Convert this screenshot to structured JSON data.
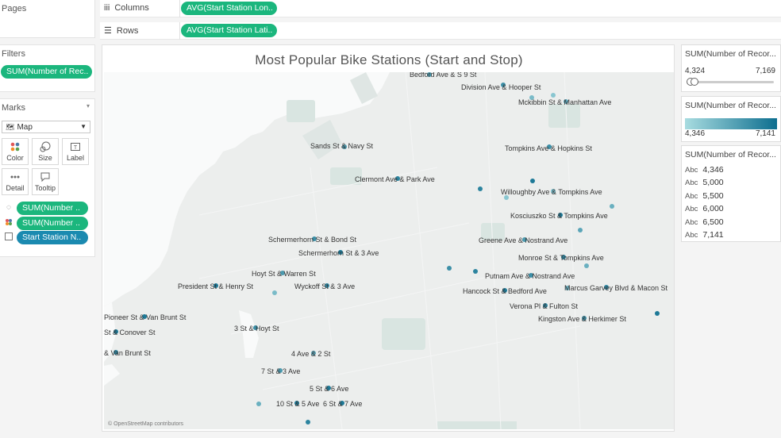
{
  "pages": {
    "label": "Pages"
  },
  "filters": {
    "label": "Filters",
    "pill": "SUM(Number of Rec.."
  },
  "marks": {
    "label": "Marks",
    "type": "Map",
    "buttons": [
      "Color",
      "Size",
      "Label",
      "Detail",
      "Tooltip"
    ],
    "pills": [
      "SUM(Number ..",
      "SUM(Number ..",
      "Start Station N.."
    ]
  },
  "shelves": {
    "columns": {
      "label": "Columns",
      "pill": "AVG(Start Station Lon.."
    },
    "rows": {
      "label": "Rows",
      "pill": "AVG(Start Station Lati.."
    }
  },
  "view": {
    "title": "Most Popular Bike Stations (Start and Stop)",
    "attribution": "© OpenStreetMap contributors"
  },
  "legends": {
    "filter": {
      "title": "SUM(Number of Recor...",
      "min": "4,324",
      "max": "7,169"
    },
    "color": {
      "title": "SUM(Number of Recor...",
      "min": "4,346",
      "max": "7,141"
    },
    "size": {
      "title": "SUM(Number of Recor...",
      "items": [
        "4,346",
        "5,000",
        "5,500",
        "6,000",
        "6,500",
        "7,141"
      ],
      "abc": "Abc"
    }
  },
  "stations": [
    {
      "name": "Bedford Ave & S 9 St"
    },
    {
      "name": "Division Ave & Hooper St"
    },
    {
      "name": "Mckibbin St & Manhattan Ave"
    },
    {
      "name": "Sands St & Navy St"
    },
    {
      "name": "Tompkins Ave & Hopkins St"
    },
    {
      "name": "Clermont Ave & Park Ave"
    },
    {
      "name": "Willoughby Ave & Tompkins Ave"
    },
    {
      "name": "Kosciuszko St & Tompkins Ave"
    },
    {
      "name": "Schermerhorn St & Bond St"
    },
    {
      "name": "Greene Ave & Nostrand Ave"
    },
    {
      "name": "Schermerhorn St & 3 Ave"
    },
    {
      "name": "Monroe St & Tompkins Ave"
    },
    {
      "name": "Hoyt St & Warren St"
    },
    {
      "name": "Putnam Ave & Nostrand Ave"
    },
    {
      "name": "President St & Henry St"
    },
    {
      "name": "Wyckoff St & 3 Ave"
    },
    {
      "name": "Marcus Garvey Blvd & Macon St"
    },
    {
      "name": "Hancock St & Bedford Ave"
    },
    {
      "name": "Verona Pl & Fulton St"
    },
    {
      "name": "Pioneer St & Van Brunt St"
    },
    {
      "name": "Kingston Ave & Herkimer St"
    },
    {
      "name": "3 St & Hoyt St"
    },
    {
      "name": "St & Conover St"
    },
    {
      "name": "& Van Brunt St"
    },
    {
      "name": "4 Ave & 2 St"
    },
    {
      "name": "7 St & 3 Ave"
    },
    {
      "name": "5 St & 6 Ave"
    },
    {
      "name": "10 St & 5 Ave"
    },
    {
      "name": "6 St & 7 Ave"
    }
  ]
}
